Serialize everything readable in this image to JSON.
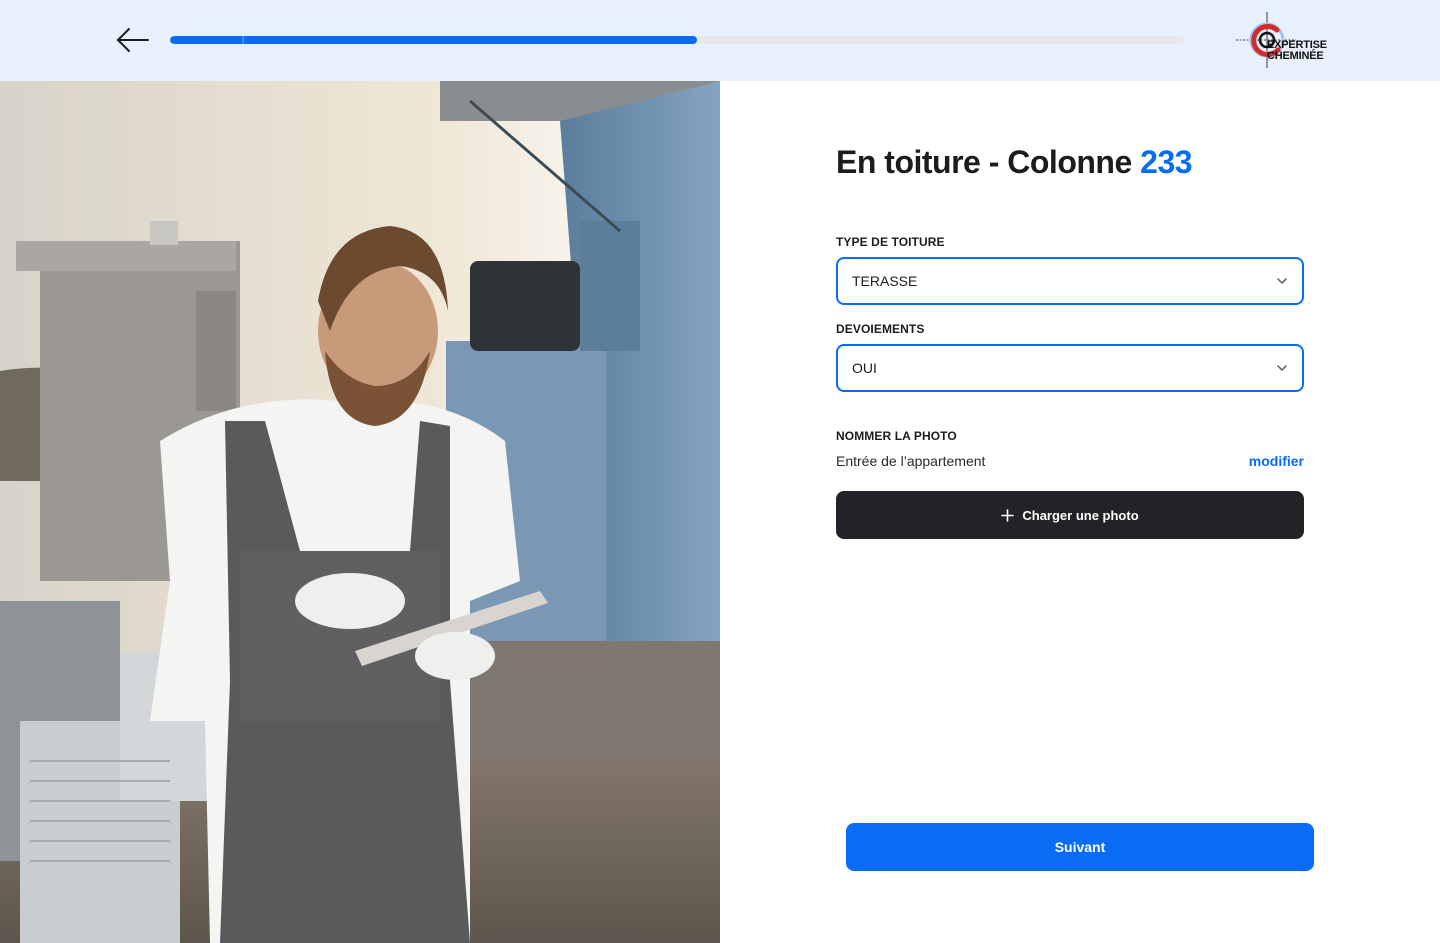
{
  "header": {
    "progress_percent": 52,
    "logo_line1": "EXPERTISE",
    "logo_line2": "CHEMINÉE"
  },
  "form": {
    "title_prefix": "En toiture - Colonne ",
    "title_number": "233",
    "roof_type": {
      "label": "TYPE DE TOITURE",
      "value": "TERASSE"
    },
    "offsets": {
      "label": "DEVOIEMENTS",
      "value": "OUI"
    },
    "photo": {
      "label": "NOMMER LA PHOTO",
      "name": "Entrée de l’appartement",
      "modify_label": "modifier",
      "upload_label": "Charger une photo"
    },
    "next_label": "Suivant"
  },
  "colors": {
    "accent": "#0a6cf5",
    "header_bg": "#e8f0fc",
    "dark_button": "#222326"
  }
}
